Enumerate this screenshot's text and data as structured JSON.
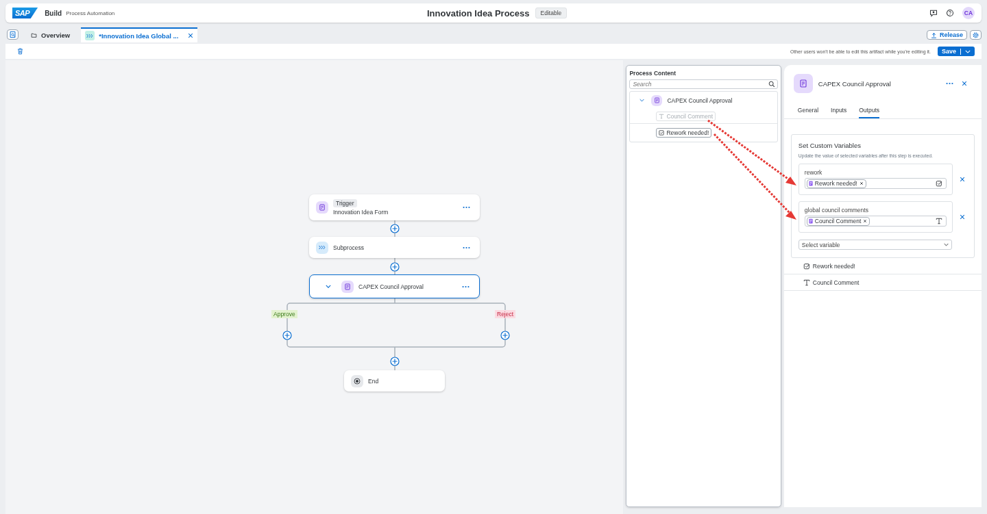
{
  "shell": {
    "logo": "SAP",
    "product": "Build",
    "subtitle": "Process Automation",
    "title": "Innovation Idea Process",
    "status": "Editable",
    "avatar": "CA"
  },
  "tabs": [
    {
      "label": "Overview",
      "kind": "folder",
      "selected": false
    },
    {
      "label": "*Innovation Idea Global ...",
      "kind": "process",
      "selected": true
    }
  ],
  "toolbar": {
    "release": "Release",
    "notice": "Other users won't be able to edit this artifact while you're editing it.",
    "save": "Save"
  },
  "canvas": {
    "nodes": [
      {
        "kind": "trigger",
        "tag": "Trigger",
        "label": "Innovation Idea Form",
        "selected": false
      },
      {
        "kind": "subprocess",
        "label": "Subprocess",
        "selected": false
      },
      {
        "kind": "approval",
        "label": "CAPEX Council Approval",
        "selected": true
      }
    ],
    "branches": [
      {
        "label": "Approve",
        "color": "#e3f2cf"
      },
      {
        "label": "Reject",
        "color": "#fbdbe2"
      }
    ],
    "end": "End"
  },
  "process_content": {
    "title": "Process Content",
    "search_placeholder": "Search",
    "tree": [
      {
        "label": "CAPEX Council Approval",
        "expanded": true,
        "children": [
          {
            "label": "Council Comment",
            "kind": "text",
            "disabled": true
          },
          {
            "label": "Rework needed!",
            "kind": "boolean",
            "disabled": false
          }
        ]
      }
    ]
  },
  "details": {
    "title": "CAPEX Council Approval",
    "tabs": [
      {
        "label": "General",
        "selected": false
      },
      {
        "label": "Inputs",
        "selected": false
      },
      {
        "label": "Outputs",
        "selected": true
      }
    ],
    "section_title": "Set Custom Variables",
    "section_hint": "Update the value of selected variables after this step is executed.",
    "variables": [
      {
        "name": "rework",
        "token": "Rework needed!",
        "kind": "boolean"
      },
      {
        "name": "global council comments",
        "token": "Council Comment",
        "kind": "text"
      }
    ],
    "select_placeholder": "Select variable",
    "outputs": [
      {
        "label": "Rework needed!",
        "kind": "boolean"
      },
      {
        "label": "Council Comment",
        "kind": "text"
      }
    ]
  }
}
